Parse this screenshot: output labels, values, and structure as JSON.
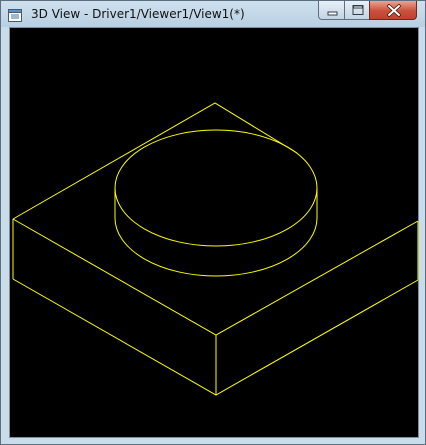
{
  "window": {
    "title": "3D View - Driver1/Viewer1/View1(*)",
    "icon": "view-window-icon"
  },
  "caption_buttons": {
    "minimize_icon": "minimize-icon",
    "maximize_icon": "maximize-icon",
    "close_icon": "close-icon"
  },
  "viewer": {
    "background_color": "#000000",
    "wire_color": "#ffff00",
    "content": "wireframe box with cylinder"
  }
}
